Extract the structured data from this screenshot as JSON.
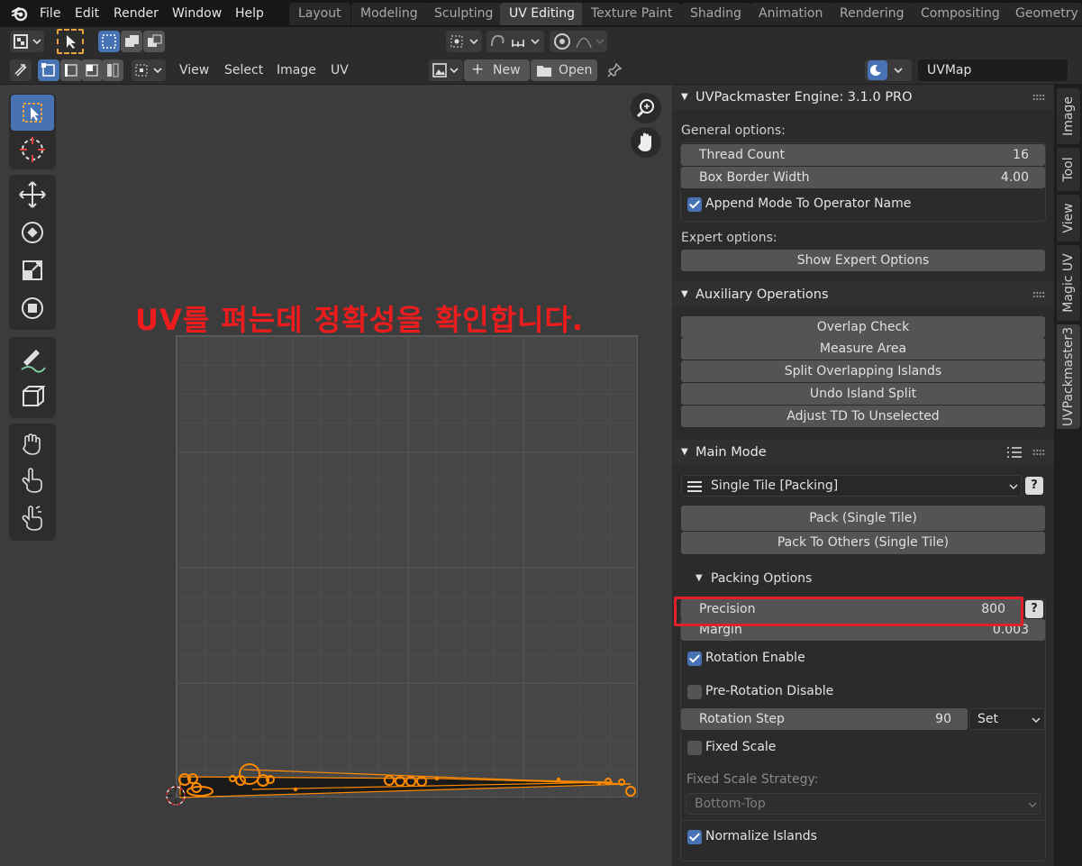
{
  "menu": {
    "file": "File",
    "edit": "Edit",
    "render": "Render",
    "window": "Window",
    "help": "Help"
  },
  "workspaces": [
    "Layout",
    "Modeling",
    "Sculpting",
    "UV Editing",
    "Texture Paint",
    "Shading",
    "Animation",
    "Rendering",
    "Compositing",
    "Geometry N"
  ],
  "active_workspace": "UV Editing",
  "header": {
    "view": "View",
    "select": "Select",
    "image": "Image",
    "uv": "UV",
    "new_label": "New",
    "open_label": "Open",
    "uvmap": "UVMap"
  },
  "annotation": "UV를 펴는데 정확성을 확인합니다.",
  "side_tabs": [
    "Image",
    "Tool",
    "View",
    "Magic UV",
    "UVPackmaster3"
  ],
  "active_side_tab": "UVPackmaster3",
  "engine_panel": {
    "title": "UVPackmaster Engine: 3.1.0 PRO",
    "general_label": "General options:",
    "thread_count_label": "Thread Count",
    "thread_count": "16",
    "box_border_label": "Box Border Width",
    "box_border": "4.00",
    "append_mode_label": "Append Mode To Operator Name",
    "append_mode": true,
    "expert_label": "Expert options:",
    "show_expert": "Show Expert Options"
  },
  "aux_panel": {
    "title": "Auxiliary Operations",
    "buttons": [
      "Overlap Check",
      "Measure Area",
      "Split Overlapping Islands",
      "Undo Island Split",
      "Adjust TD To Unselected"
    ]
  },
  "main_mode": {
    "title": "Main Mode",
    "mode": "Single Tile [Packing]",
    "pack": "Pack (Single Tile)",
    "pack_others": "Pack To Others (Single Tile)",
    "packing_options": "Packing Options",
    "precision_label": "Precision",
    "precision": "800",
    "margin_label": "Margin",
    "margin": "0.003",
    "rotation_enable": "Rotation Enable",
    "rotation_enable_on": true,
    "pre_rotation": "Pre-Rotation Disable",
    "pre_rotation_on": false,
    "rotation_step_label": "Rotation Step",
    "rotation_step": "90",
    "set_label": "Set",
    "fixed_scale": "Fixed Scale",
    "fixed_scale_on": false,
    "fixed_scale_strategy_label": "Fixed Scale Strategy:",
    "fixed_scale_strategy": "Bottom-Top",
    "normalize": "Normalize Islands",
    "normalize_on": true
  },
  "colors": {
    "accent": "#4772b3",
    "highlight": "#e0202a",
    "uv_select": "#ff8a00"
  }
}
